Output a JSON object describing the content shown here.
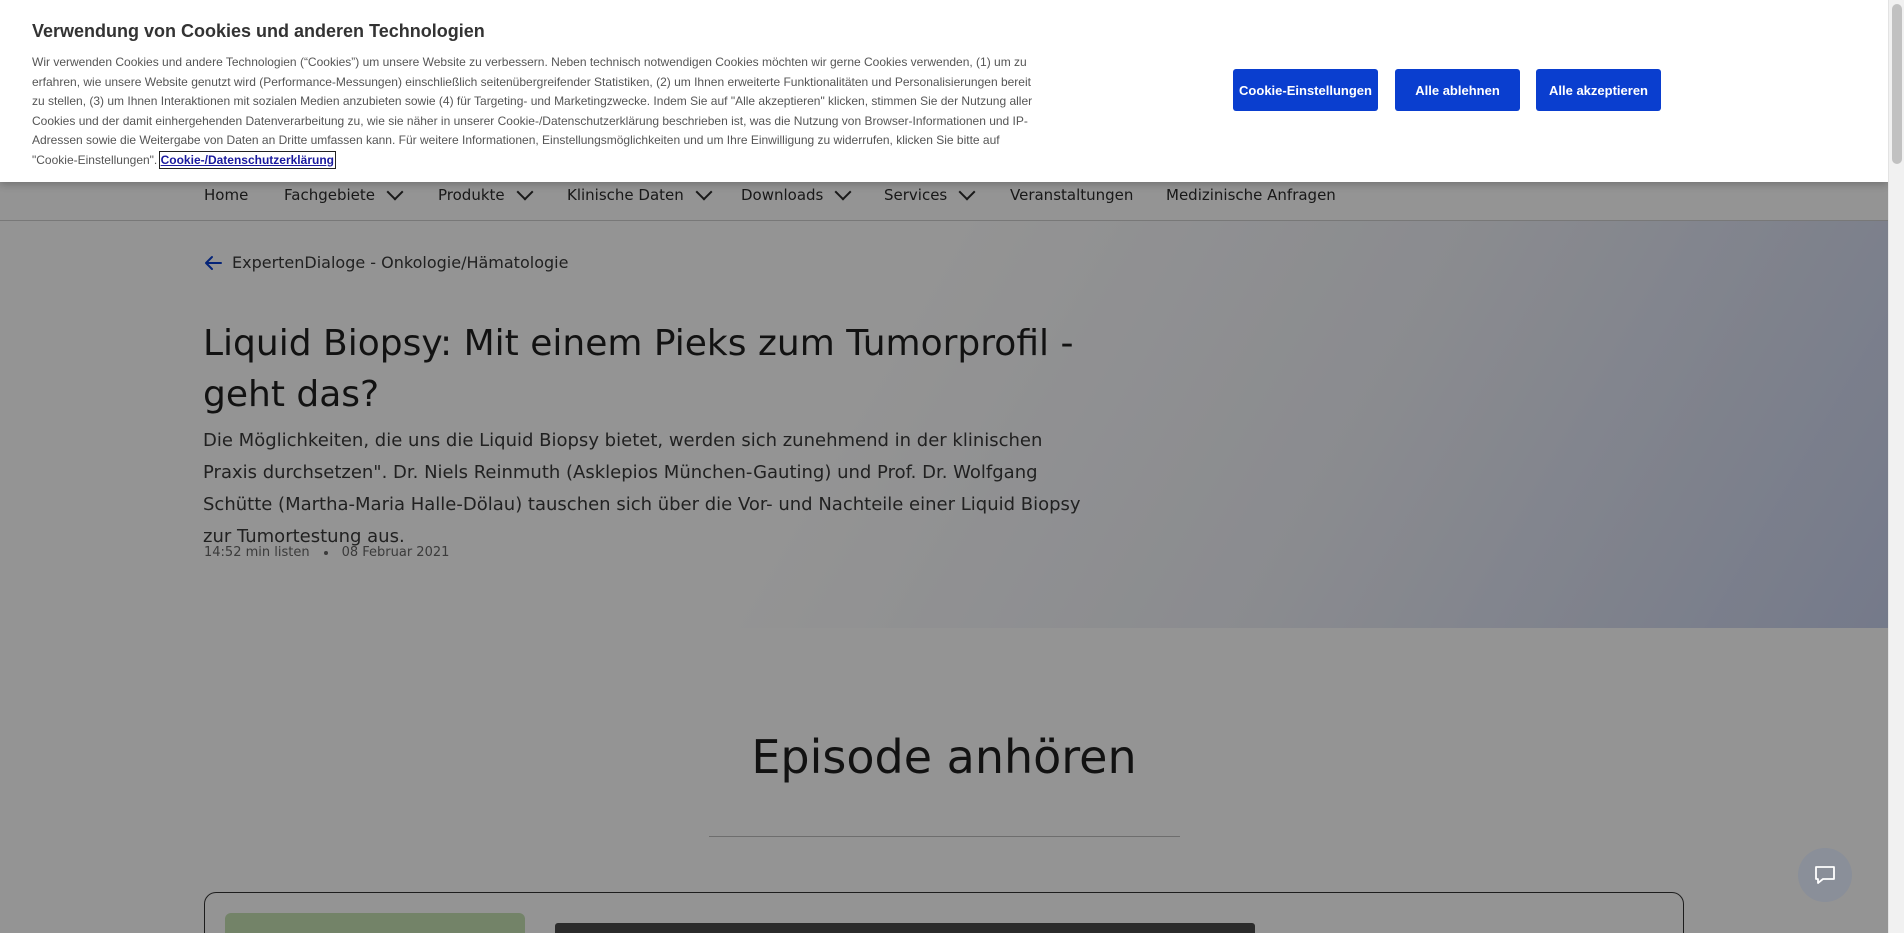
{
  "nav": {
    "items": [
      {
        "label": "Home",
        "dropdown": false
      },
      {
        "label": "Fachgebiete",
        "dropdown": true
      },
      {
        "label": "Produkte",
        "dropdown": true
      },
      {
        "label": "Klinische Daten",
        "dropdown": true
      },
      {
        "label": "Downloads",
        "dropdown": true
      },
      {
        "label": "Services",
        "dropdown": true
      },
      {
        "label": "Veranstaltungen",
        "dropdown": false
      },
      {
        "label": "Medizinische Anfragen",
        "dropdown": false
      }
    ]
  },
  "breadcrumb": {
    "back_label": "ExpertenDialoge - Onkologie/Hämatologie",
    "icon": "arrow-left-icon"
  },
  "article": {
    "title": "Liquid Biopsy: Mit einem Pieks zum Tumorprofil - geht das?",
    "lead": "Die Möglichkeiten, die uns die Liquid Biopsy bietet, werden sich zunehmend in der klinischen Praxis durchsetzen\". Dr. Niels Reinmuth (Asklepios München-Gauting) und Prof. Dr. Wolfgang Schütte (Martha-Maria Halle-Dölau) tauschen sich über die Vor- und Nachteile einer Liquid Biopsy zur Tumortestung aus.",
    "duration": "14:52 min listen",
    "date": "08 Februar 2021"
  },
  "episode": {
    "heading": "Episode anhören"
  },
  "cookie_banner": {
    "title": "Verwendung von Cookies und anderen Technologien",
    "text": "Wir verwenden Cookies und andere Technologien (“Cookies”) um unsere Website zu verbessern. Neben technisch notwendigen Cookies möchten wir gerne Cookies verwenden, (1) um zu erfahren, wie unsere Website genutzt wird (Performance-Messungen) einschließlich seitenübergreifender Statistiken, (2) um Ihnen erweiterte Funktionalitäten und Personalisierungen bereit zu stellen, (3) um Ihnen Interaktionen mit sozialen Medien anzubieten sowie (4) für Targeting- und Marketingzwecke. Indem Sie auf \"Alle akzeptieren\" klicken, stimmen Sie der Nutzung aller Cookies und der damit einhergehenden Datenverarbeitung zu, wie sie näher in unserer Cookie-/Datenschutzerklärung beschrieben ist, was die Nutzung von Browser-Informationen und IP-Adressen sowie die Weitergabe von Daten an Dritte umfassen kann. Für weitere Informationen, Einstellungsmöglichkeiten und um Ihre Einwilligung zu widerrufen, klicken Sie bitte auf \"Cookie-Einstellungen\".",
    "link_label": "Cookie-/Datenschutzerklärung",
    "buttons": {
      "settings": "Cookie-Einstellungen",
      "reject": "Alle ablehnen",
      "accept": "Alle akzeptieren"
    }
  },
  "colors": {
    "button_blue": "#0a3ecf",
    "overlay": "rgba(0,0,0,0.42)"
  },
  "chat": {
    "icon": "chat-icon"
  }
}
